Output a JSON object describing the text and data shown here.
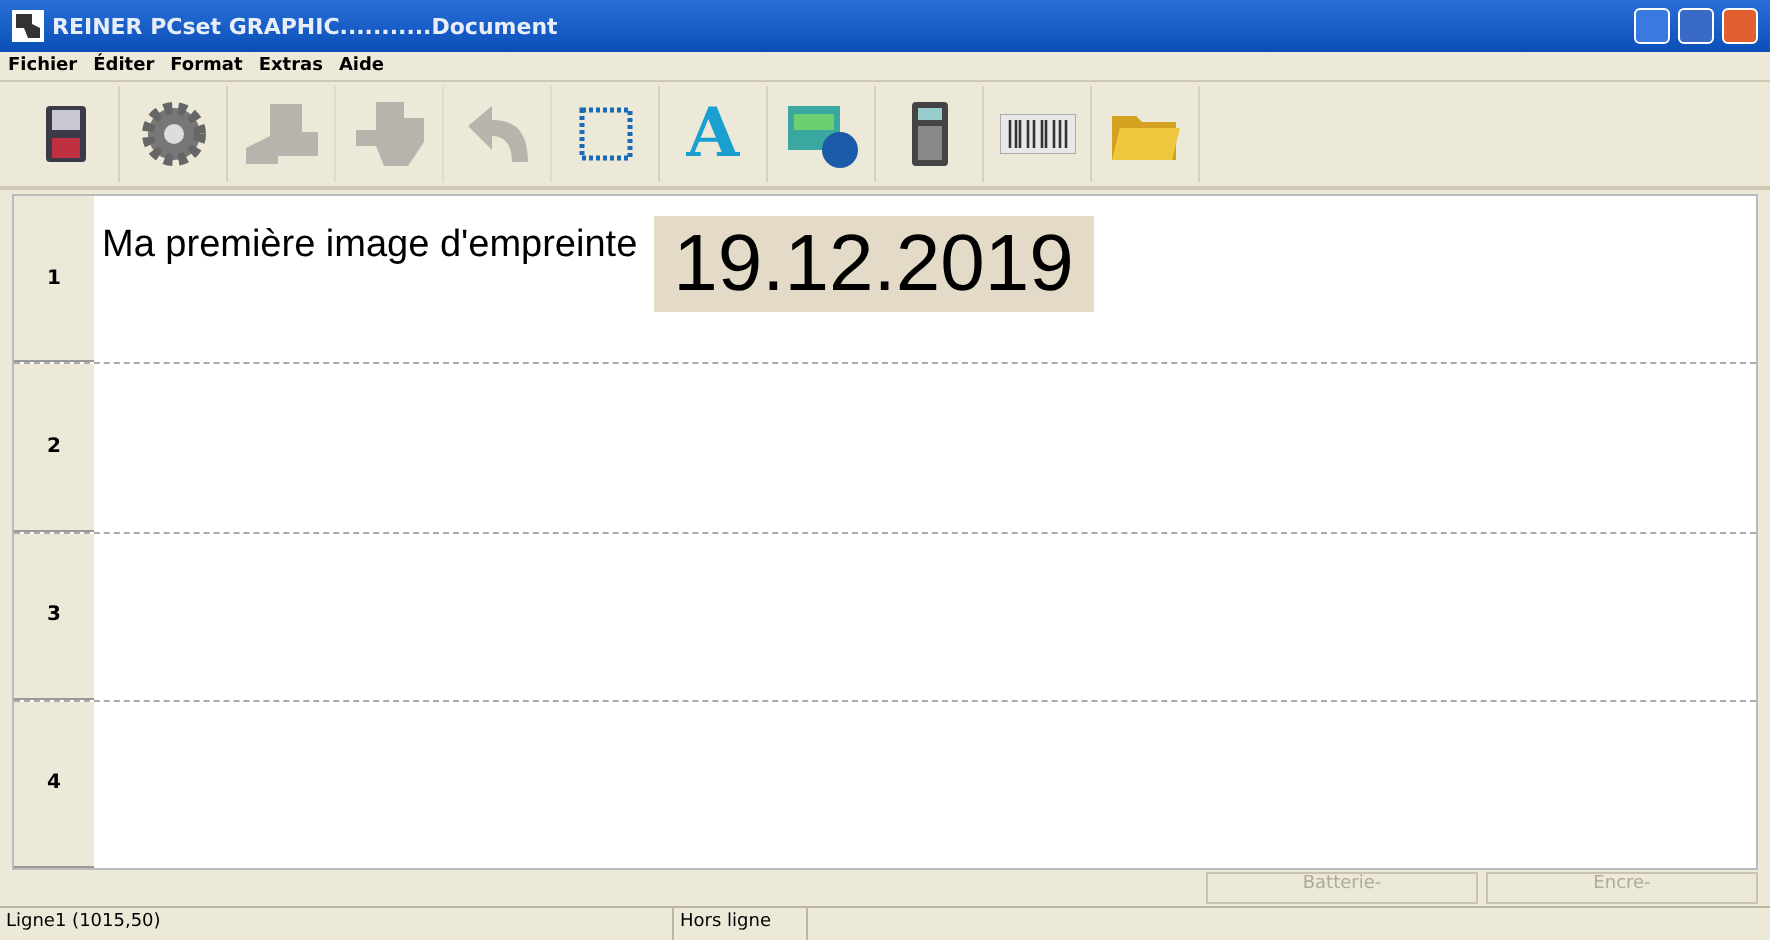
{
  "window": {
    "title": "REINER PCset GRAPHIC...........Document"
  },
  "menu": [
    "Fichier",
    "Éditer",
    "Format",
    "Extras",
    "Aide"
  ],
  "toolbar": [
    {
      "kind": "floppy",
      "disabled": false
    },
    {
      "kind": "gear",
      "disabled": false
    },
    {
      "kind": "stamp",
      "disabled": true
    },
    {
      "kind": "stamp2",
      "disabled": true
    },
    {
      "kind": "undo",
      "disabled": true
    },
    {
      "kind": "frame",
      "disabled": false
    },
    {
      "kind": "letter",
      "glyph": "A",
      "disabled": false
    },
    {
      "kind": "picture",
      "disabled": false
    },
    {
      "kind": "calculator",
      "disabled": false
    },
    {
      "kind": "barcode",
      "disabled": false
    },
    {
      "kind": "folder",
      "disabled": false
    }
  ],
  "lines": [
    {
      "number": "1",
      "text": "Ma première image d'empreinte",
      "date": "19.12.2019"
    },
    {
      "number": "2"
    },
    {
      "number": "3"
    },
    {
      "number": "4"
    }
  ],
  "indicators": [
    {
      "label": "Batterie-",
      "disabled": true
    },
    {
      "label": "Encre-",
      "disabled": true
    }
  ],
  "status_bar": {
    "position": "Ligne1 (1015,50)",
    "connection": "Hors ligne"
  }
}
